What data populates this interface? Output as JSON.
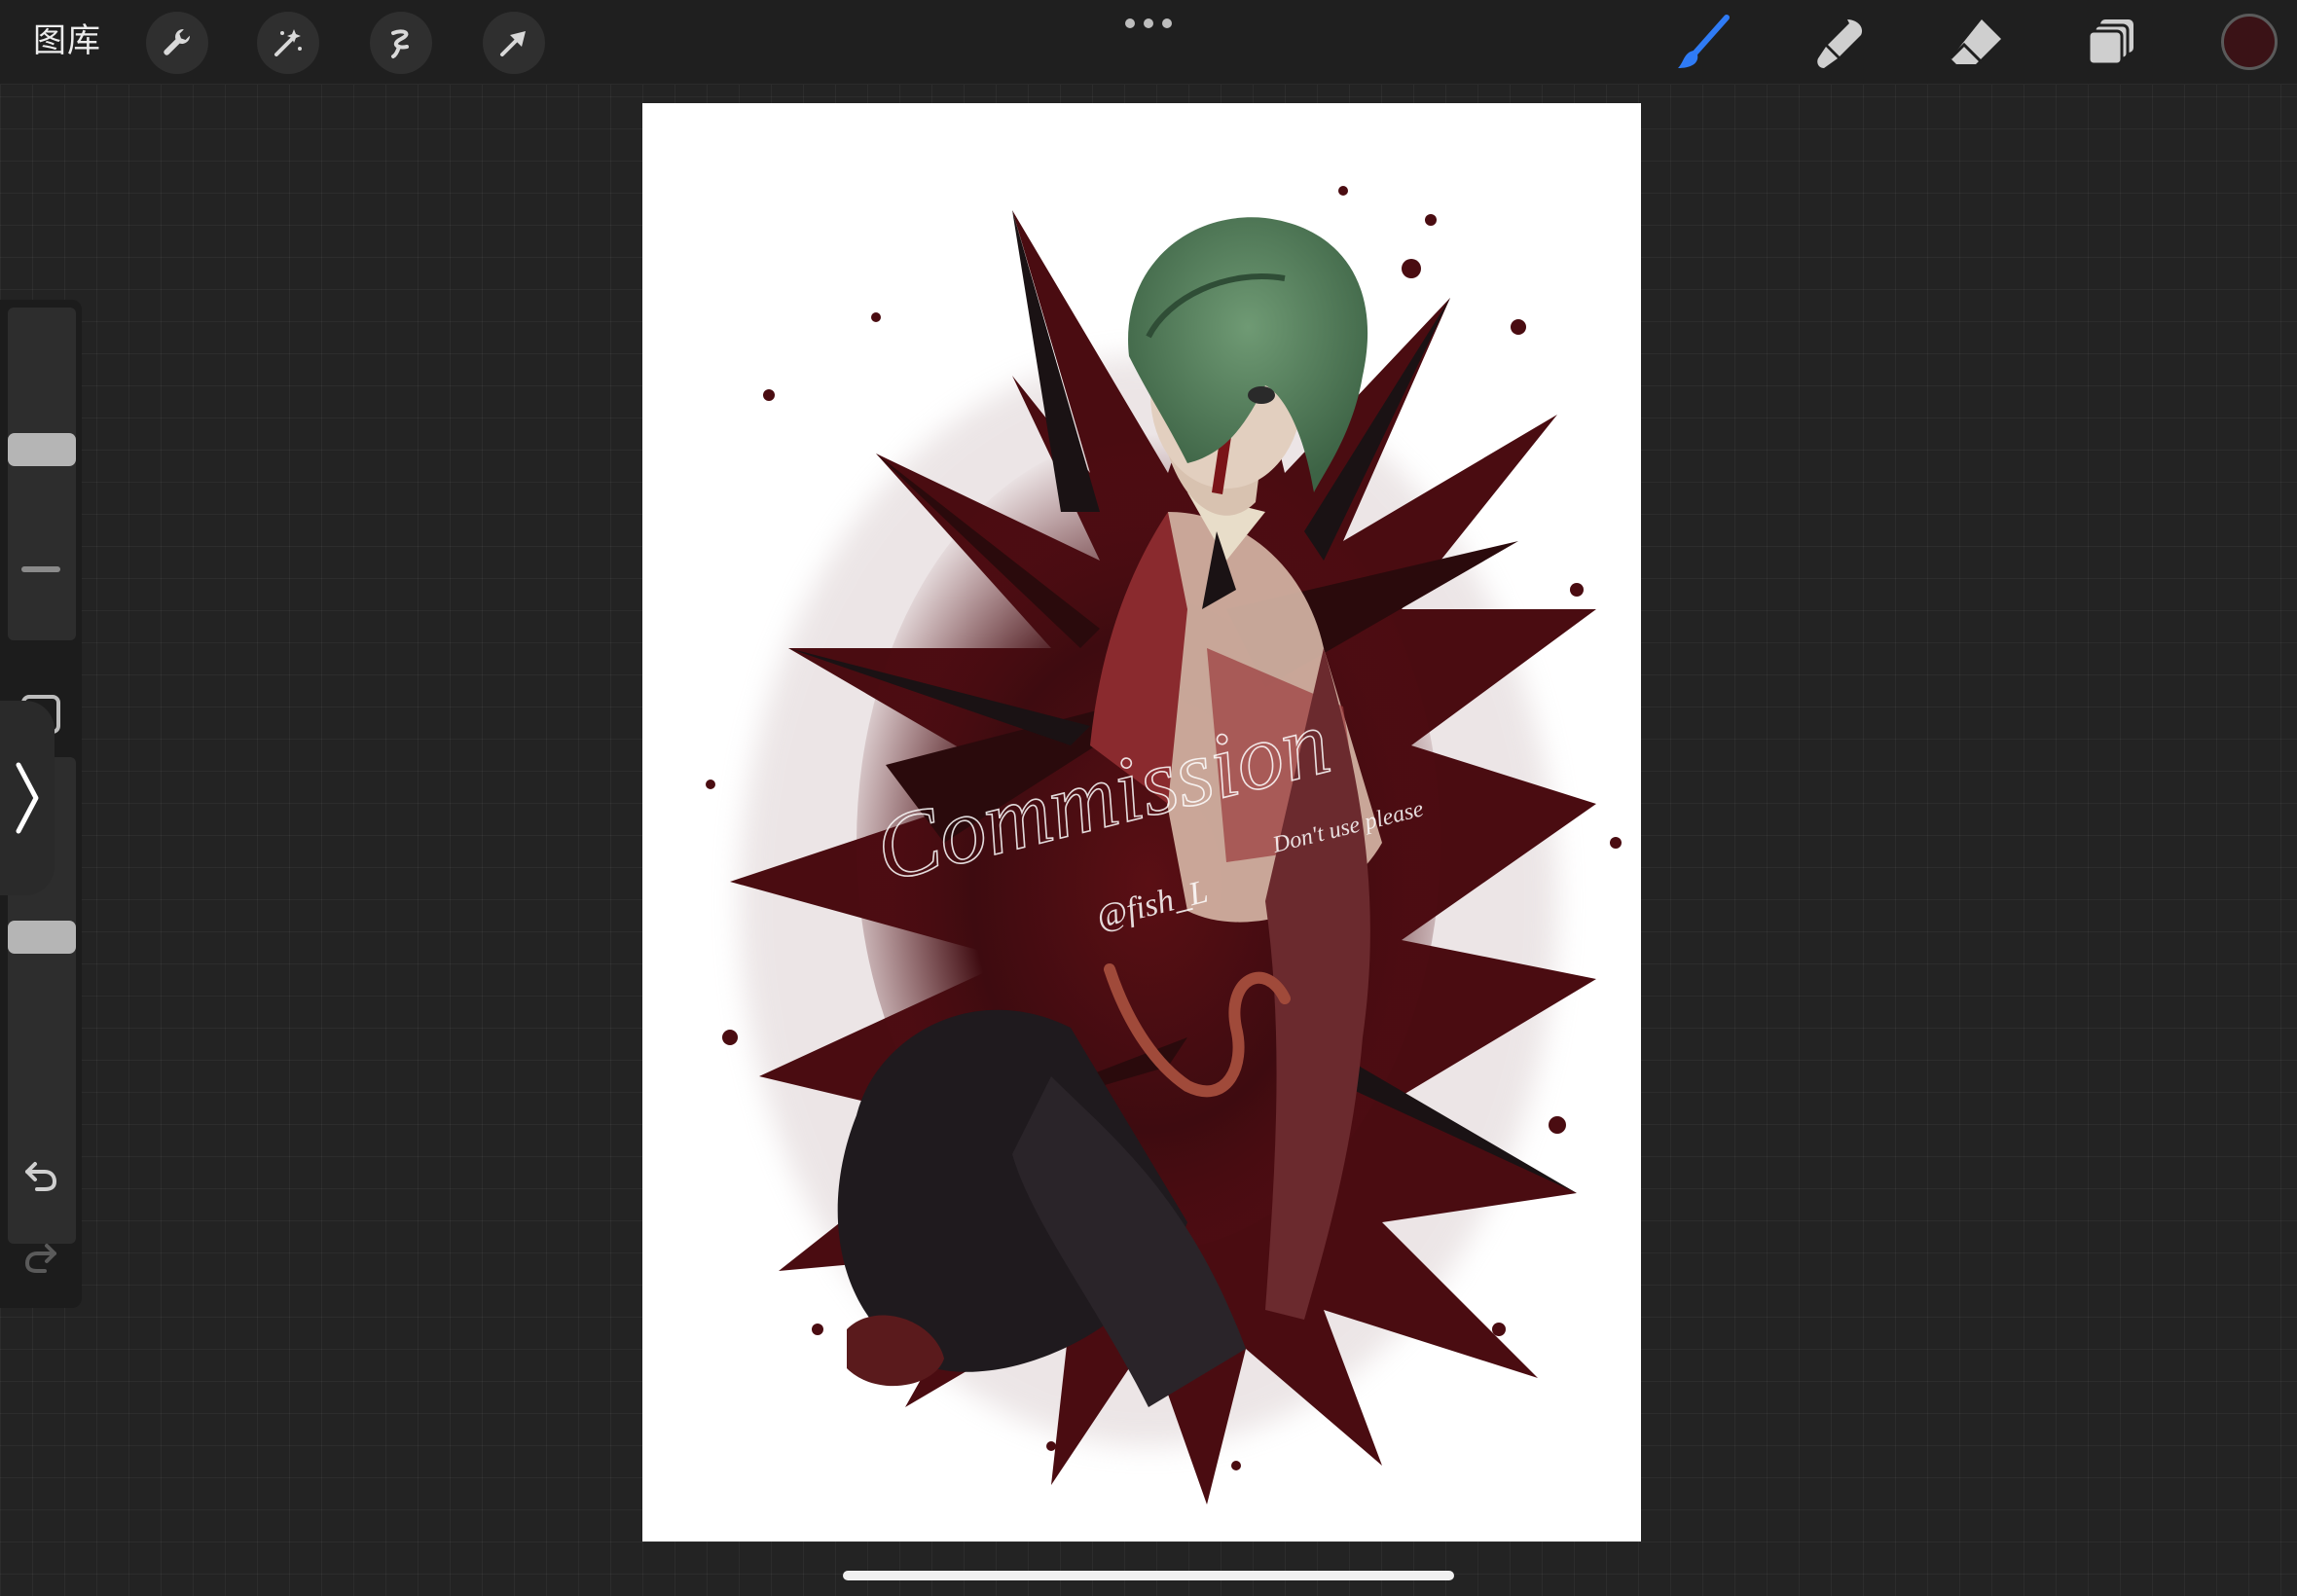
{
  "app": {
    "gallery_label": "图库"
  },
  "toolbar": {
    "left_icons": [
      "wrench-icon",
      "magic-wand-icon",
      "selection-icon",
      "transform-arrow-icon"
    ],
    "right_icons": [
      "brush-icon",
      "smudge-icon",
      "eraser-icon",
      "layers-icon"
    ],
    "active_tool": "brush",
    "active_color": "#3a1216",
    "accent": "#2f7bf5"
  },
  "sidebar": {
    "brush_size": 0.58,
    "opacity": 0.64,
    "icons": [
      "modify-square-icon",
      "undo-icon",
      "redo-icon",
      "collapse-chevron-icon"
    ]
  },
  "artwork": {
    "watermark_title": "Commission",
    "watermark_handle": "@fish_L",
    "watermark_note": "Don't use please",
    "hair_color": "#4e7a55",
    "splatter_color": "#5a0f14",
    "dark_color": "#1a1214"
  }
}
